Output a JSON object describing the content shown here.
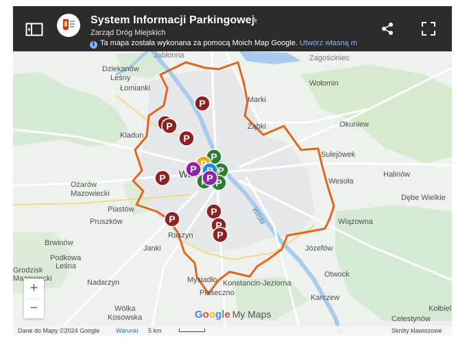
{
  "header": {
    "title": "System Informacji Parkingowej",
    "subtitle": "Zarząd Dróg Miejskich",
    "notice_text": "Ta mapa została wykonana za pomocą Moich Map Google.",
    "create_link": "Utwórz własną m",
    "star_glyph": "★",
    "info_glyph": "i",
    "icons": [
      "panel-toggle-icon",
      "share-icon",
      "fullscreen-icon",
      "logo-icon",
      "star-icon",
      "info-icon"
    ]
  },
  "places": {
    "jablonna": "Jabłonna",
    "zagosciniec": "Zagościniec",
    "dziekanow": "Dziekanów",
    "lesny": "Leśny",
    "lomianki": "Łomianki",
    "wolomin": "Wołomin",
    "marki": "Marki",
    "zabki": "Ząbki",
    "kladno": "Kladun",
    "okuniew": "Okuniew",
    "sulejowek": "Sulejówek",
    "halinow": "Halinów",
    "wesola": "Wesoła",
    "warszawa": "Warszawa",
    "ozarow": "Ożarów",
    "mazowiecki": "Mazowiecki",
    "piastow": "Piastów",
    "debe": "Dębe Wielkie",
    "pruszkow": "Pruszków",
    "wiazowna": "Wiązowna",
    "wisla": "Wisła",
    "raszyn": "Raszyn",
    "jozefow": "Józefów",
    "brwinow": "Brwinów",
    "janki": "Janki",
    "podkowa": "Podkowa",
    "lesna": "Leśna",
    "otwock": "Otwock",
    "grodzisk": "Grodzisk",
    "mazowiecki2": "Mazowiecki",
    "nadarzyn": "Nadarzyn",
    "mysiadlo": "Mysiadło",
    "konstancin": "Konstancin-Jeziorna",
    "piaseczno": "Piaseczno",
    "karczew": "Karczew",
    "wolka": "Wólka",
    "kosowska": "Kosowska",
    "kolbiel": "Kołbiel",
    "celestynow": "Celestynów"
  },
  "zoom": {
    "in_label": "+",
    "out_label": "−"
  },
  "brand": {
    "g1": "G",
    "g2": "o",
    "g3": "o",
    "g4": "g",
    "g5": "l",
    "g6": "e",
    "my_maps": "My Maps"
  },
  "footer": {
    "attribution": "Dane do Mapy ©2024 Google",
    "terms": "Warunki",
    "scale": "5 km",
    "shortcuts": "Skróty klawiszowe"
  },
  "marker_label": "P",
  "markers": [
    {
      "kind": "parking",
      "color": "#8b2323"
    },
    {
      "kind": "park-and-ride-green",
      "color": "#2e7d32"
    },
    {
      "kind": "park-and-ride-yellow",
      "color": "#f2a71b"
    },
    {
      "kind": "park-and-ride-purple",
      "color": "#8e24aa"
    },
    {
      "kind": "park-and-ride-blue",
      "color": "#1e88e5"
    }
  ],
  "boundary_color": "#e0661d"
}
